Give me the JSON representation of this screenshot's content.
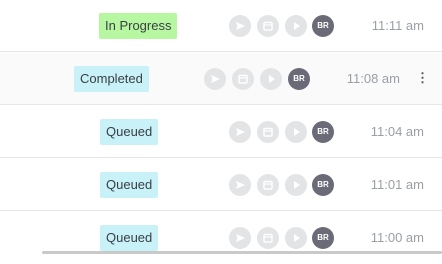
{
  "rows": [
    {
      "status": "In Progress",
      "status_type": "in-progress",
      "assignee_initials": "BR",
      "time": "11:11 am"
    },
    {
      "status": "Completed",
      "status_type": "completed",
      "assignee_initials": "BR",
      "time": "11:08 am"
    },
    {
      "status": "Queued",
      "status_type": "queued",
      "assignee_initials": "BR",
      "time": "11:04 am"
    },
    {
      "status": "Queued",
      "status_type": "queued",
      "assignee_initials": "BR",
      "time": "11:01 am"
    },
    {
      "status": "Queued",
      "status_type": "queued",
      "assignee_initials": "BR",
      "time": "11:00 am"
    }
  ],
  "icons": {
    "action_1": "send-icon",
    "action_2": "calendar-icon",
    "action_3": "play-icon",
    "more": "more-vertical-icon"
  },
  "colors": {
    "in_progress_badge": "#b8f7a2",
    "completed_badge": "#c8f1f8",
    "queued_badge": "#c8f1f8",
    "avatar": "#6b6b78",
    "action_icon_bg": "#e3e4e6"
  }
}
